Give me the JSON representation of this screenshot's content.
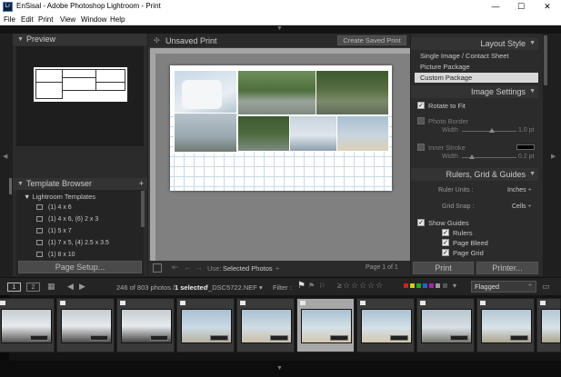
{
  "window": {
    "title": "EnSisal - Adobe Photoshop Lightroom - Print",
    "minimize": "—",
    "maximize": "☐",
    "close": "✕"
  },
  "menu": [
    "File",
    "Edit",
    "Print",
    "View",
    "Window",
    "Help"
  ],
  "left": {
    "preview_title": "Preview",
    "template_browser_title": "Template Browser",
    "add_icon": "+",
    "folder": "Lightroom Templates",
    "templates": [
      "(1) 4 x 6",
      "(1) 4 x 6, (6) 2 x 3",
      "(1) 5 x 7",
      "(1) 7 x 5, (4) 2.5 x 3.5",
      "(1) 8 x 10"
    ],
    "page_setup": "Page Setup..."
  },
  "center": {
    "title": "Unsaved Print",
    "create_saved_print": "Create Saved Print",
    "use_label": "Use:",
    "use_value": "Selected Photos",
    "page_info": "Page 1 of 1"
  },
  "right": {
    "layout_style_title": "Layout Style",
    "layout_options": [
      "Single Image / Contact Sheet",
      "Picture Package",
      "Custom Package"
    ],
    "image_settings_title": "Image Settings",
    "rotate_to_fit": "Rotate to Fit",
    "photo_border": "Photo Border",
    "width_label": "Width",
    "photo_border_width": "1.0 pt",
    "inner_stroke": "Inner Stroke",
    "inner_stroke_width": "0.2 pt",
    "rulers_title": "Rulers, Grid & Guides",
    "ruler_units_label": "Ruler Units :",
    "ruler_units_value": "Inches ÷",
    "grid_snap_label": "Grid Snap :",
    "grid_snap_value": "Cells ÷",
    "show_guides": "Show Guides",
    "rulers": "Rulers",
    "page_bleed": "Page Bleed",
    "page_grid": "Page Grid",
    "print_button": "Print",
    "printer_button": "Printer..."
  },
  "filmstrip": {
    "page1": "1",
    "page2": "2",
    "count_prefix": "246 of 803 photos /",
    "selected": "1 selected",
    "filename": "/_DSC5722.NEF ▾",
    "filter_label": "Filter :",
    "flagged": "Flagged"
  },
  "colors": {
    "accent_selected": "#d8d8d8",
    "panel_bg": "#2b2b2b",
    "grid_line": "#c8dbe8"
  }
}
